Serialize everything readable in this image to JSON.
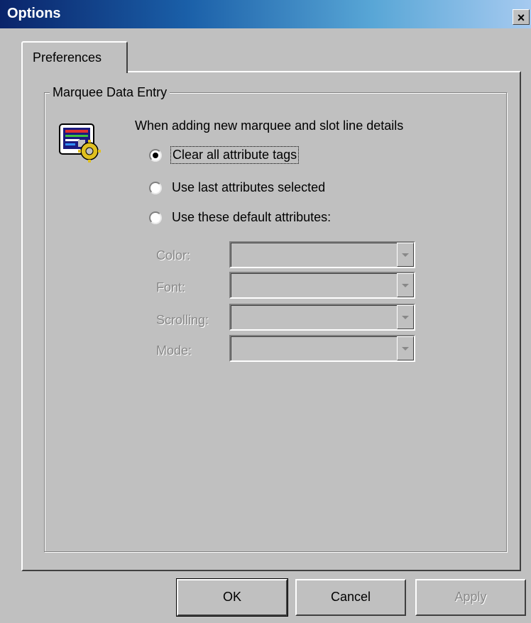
{
  "window": {
    "title": "Options",
    "close_label": "×"
  },
  "tabs": [
    {
      "label": "Preferences",
      "selected": true
    }
  ],
  "group": {
    "label": "Marquee Data Entry",
    "intro": "When adding new marquee and slot line details",
    "icon": "marquee-settings-icon",
    "options": [
      {
        "label": "Clear all attribute tags",
        "checked": true
      },
      {
        "label": "Use last attributes selected",
        "checked": false
      },
      {
        "label": "Use these default attributes:",
        "checked": false
      }
    ],
    "fields": [
      {
        "label": "Color:",
        "value": ""
      },
      {
        "label": "Font:",
        "value": ""
      },
      {
        "label": "Scrolling:",
        "value": ""
      },
      {
        "label": "Mode:",
        "value": ""
      }
    ]
  },
  "buttons": {
    "ok": "OK",
    "cancel": "Cancel",
    "apply": "Apply"
  }
}
